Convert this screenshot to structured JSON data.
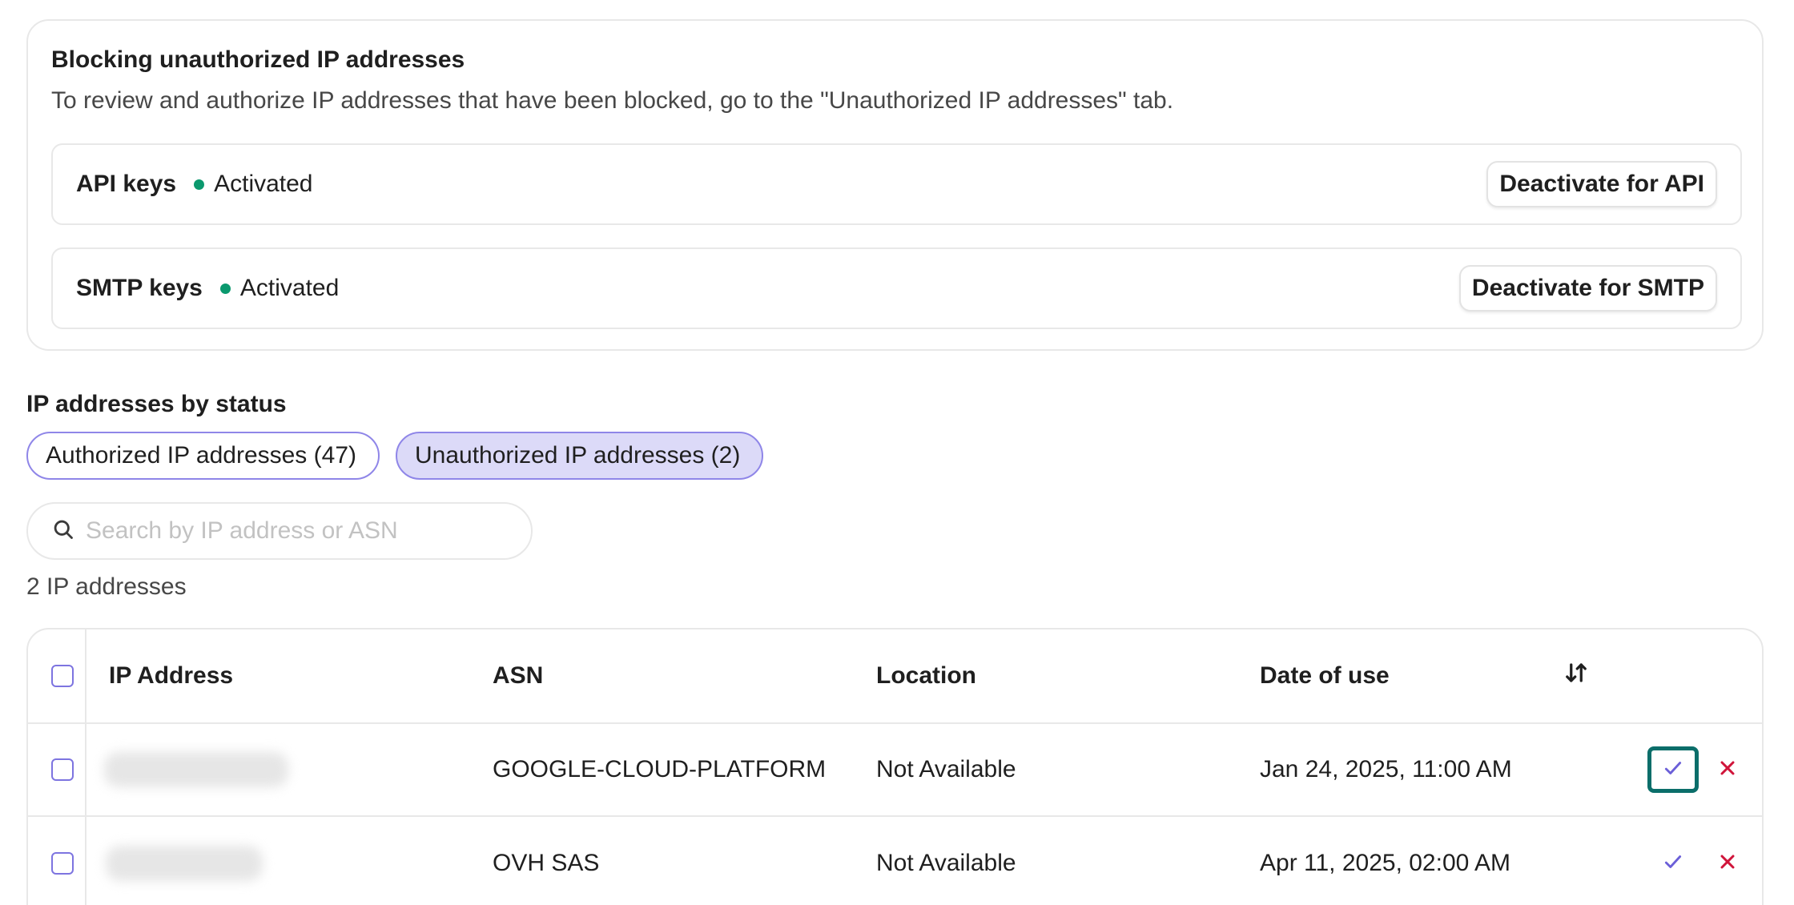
{
  "blocking": {
    "title": "Blocking unauthorized IP addresses",
    "description": "To review and authorize IP addresses that have been blocked, go to the \"Unauthorized IP addresses\" tab.",
    "api": {
      "label": "API keys",
      "status": "Activated",
      "button": "Deactivate for API"
    },
    "smtp": {
      "label": "SMTP keys",
      "status": "Activated",
      "button": "Deactivate for SMTP"
    },
    "status_color": "#0b996e"
  },
  "status_section": {
    "heading": "IP addresses by status",
    "tabs": [
      {
        "label": "Authorized IP addresses (47)",
        "selected": false
      },
      {
        "label": "Unauthorized IP addresses (2)",
        "selected": true
      }
    ]
  },
  "search": {
    "placeholder": "Search by IP address or ASN",
    "value": ""
  },
  "count_text": "2 IP addresses",
  "table": {
    "columns": {
      "ip": "IP Address",
      "asn": "ASN",
      "location": "Location",
      "date": "Date of use"
    },
    "rows": [
      {
        "ip": "",
        "asn": "GOOGLE-CLOUD-PLATFORM",
        "location": "Not Available",
        "date": "Jan 24, 2025, 11:00 AM",
        "ip_redacted": true
      },
      {
        "ip": "",
        "asn": "OVH SAS",
        "location": "Not Available",
        "date": "Apr 11, 2025, 02:00 AM",
        "ip_redacted": true
      }
    ]
  },
  "colors": {
    "accent": "#7d74e0",
    "selected_tab_bg": "#dcdaf8",
    "approve": "#6b5fd8",
    "reject": "#d0143a",
    "focus_ring": "#0b6e6a"
  },
  "icons": {
    "search": "search-icon",
    "sort": "sort-icon",
    "approve": "checkmark-icon",
    "reject": "close-icon"
  }
}
